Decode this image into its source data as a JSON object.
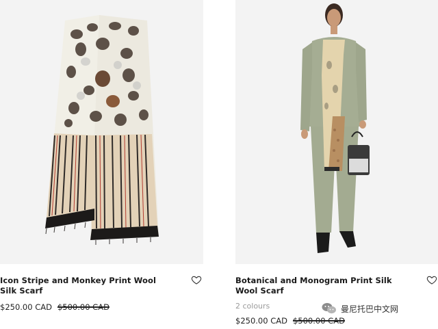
{
  "products": [
    {
      "name": "Icon Stripe and Monkey Print Wool Silk Scarf",
      "price": "$250.00 CAD",
      "original_price": "$500.00 CAD",
      "image_icon": "scarf-image"
    },
    {
      "name": "Botanical and Monogram Print Silk Wool Scarf",
      "colours": "2 colours",
      "price": "$250.00 CAD",
      "original_price": "$500.00 CAD",
      "image_icon": "model-image"
    }
  ],
  "watermark": {
    "text": "曼尼托巴中文网"
  },
  "colors": {
    "background": "#ffffff",
    "image_bg": "#f3f3f3",
    "text": "#1a1a1a",
    "muted": "#9a9a9a"
  }
}
